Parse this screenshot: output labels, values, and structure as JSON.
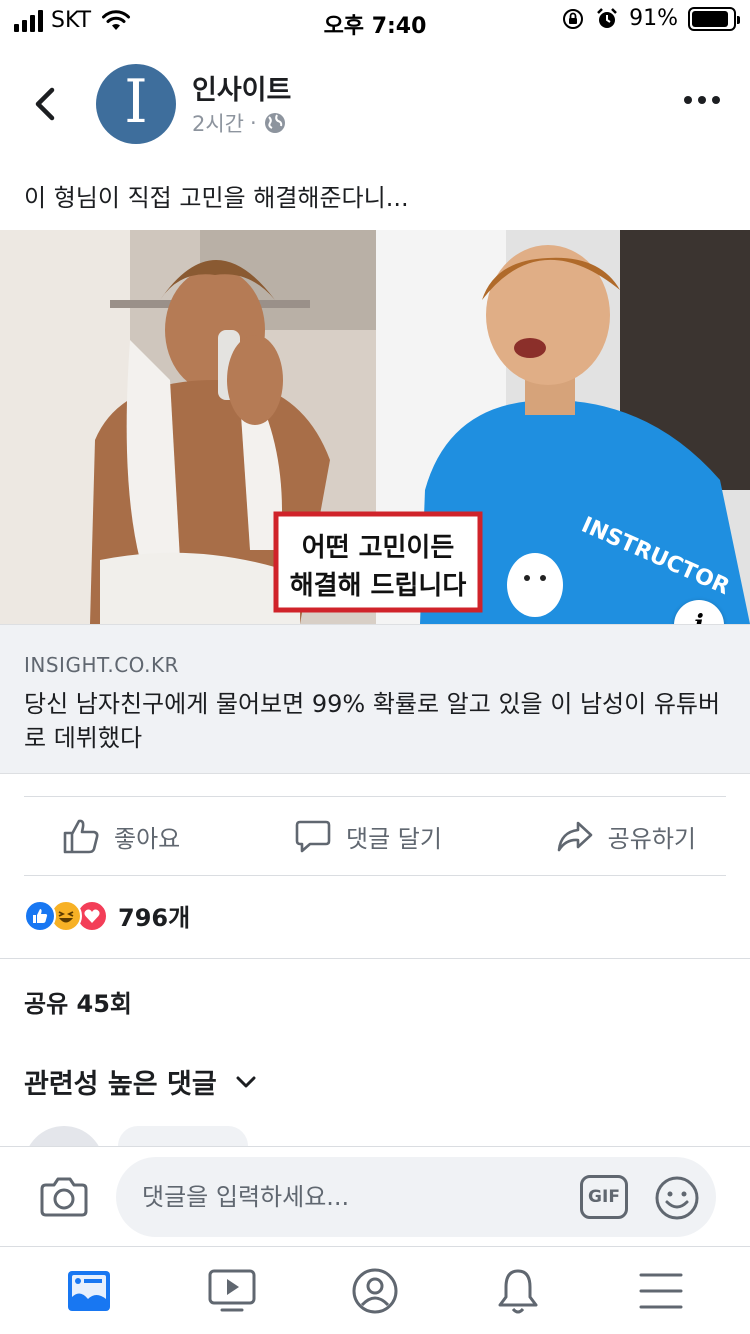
{
  "status_bar": {
    "carrier": "SKT",
    "time": "오후 7:40",
    "battery_percent": "91%",
    "battery_level": 0.91
  },
  "post": {
    "page_name": "인사이트",
    "avatar_letter": "I",
    "time_ago": "2시간",
    "meta_separator": "·",
    "text": "이 형님이 직접 고민을 해결해준다니...",
    "image_overlay_line1": "어떤 고민이든",
    "image_overlay_line2": "해결해 드립니다",
    "shirt_text": "INSTRUCTOR",
    "link_domain": "INSIGHT.CO.KR",
    "link_title": "당신 남자친구에게 물어보면 99% 확률로 알고 있을 이 남성이 유튜버로 데뷔했다",
    "info_label": "i"
  },
  "actions": {
    "like": "좋아요",
    "comment": "댓글 달기",
    "share": "공유하기"
  },
  "stats": {
    "reaction_count": "796개",
    "share_count": "공유 45회"
  },
  "comments": {
    "sort_label": "관련성 높은 댓글"
  },
  "composer": {
    "placeholder": "댓글을 입력하세요...",
    "gif_label": "GIF"
  },
  "colors": {
    "accent": "#1877f2",
    "text": "#1c1e21",
    "secondary": "#606770",
    "avatar": "#3e6e9c",
    "overlay_border": "#d0232a"
  },
  "icons": [
    "back-icon",
    "globe-icon",
    "more-icon",
    "like-icon",
    "comment-icon",
    "share-icon",
    "chevron-down-icon",
    "camera-icon",
    "gif-icon",
    "emoji-icon",
    "news-feed-icon",
    "video-icon",
    "profile-icon",
    "bell-icon",
    "menu-icon"
  ]
}
